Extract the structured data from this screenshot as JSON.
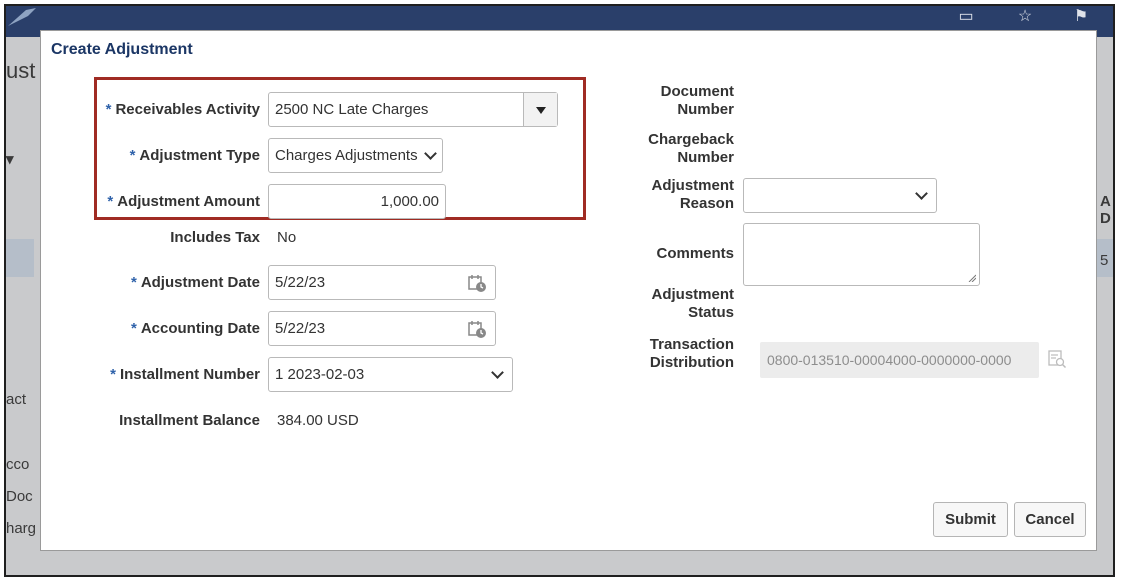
{
  "dialog": {
    "title": "Create Adjustment",
    "required_marker": "*"
  },
  "form": {
    "receivables_activity": {
      "label": "Receivables Activity",
      "value": "2500 NC Late Charges"
    },
    "adjustment_type": {
      "label": "Adjustment Type",
      "value": "Charges Adjustments"
    },
    "adjustment_amount": {
      "label": "Adjustment Amount",
      "value": "1,000.00"
    },
    "includes_tax": {
      "label": "Includes Tax",
      "value": "No"
    },
    "adjustment_date": {
      "label": "Adjustment Date",
      "value": "5/22/23"
    },
    "accounting_date": {
      "label": "Accounting Date",
      "value": "5/22/23"
    },
    "installment_number": {
      "label": "Installment Number",
      "value": "1 2023-02-03"
    },
    "installment_balance": {
      "label": "Installment Balance",
      "value": "384.00 USD"
    }
  },
  "right": {
    "document_number": {
      "label_line1": "Document",
      "label_line2": "Number"
    },
    "chargeback_number": {
      "label_line1": "Chargeback",
      "label_line2": "Number"
    },
    "adjustment_reason": {
      "label_line1": "Adjustment",
      "label_line2": "Reason",
      "value": ""
    },
    "comments": {
      "label": "Comments",
      "value": ""
    },
    "adjustment_status": {
      "label_line1": "Adjustment",
      "label_line2": "Status"
    },
    "transaction_distribution": {
      "label_line1": "Transaction",
      "label_line2": "Distribution",
      "value": "0800-013510-00004000-0000000-0000"
    }
  },
  "buttons": {
    "submit": "Submit",
    "cancel": "Cancel"
  },
  "background": {
    "left_fragments": [
      "ust",
      "act",
      "cco",
      "Doc",
      "harg"
    ],
    "right_fragments": [
      "A",
      "D",
      "5"
    ]
  },
  "colors": {
    "header_bar": "#2a3f6a",
    "title": "#1b3665",
    "required_star": "#2f62aa",
    "highlight_box": "#a02b23"
  }
}
